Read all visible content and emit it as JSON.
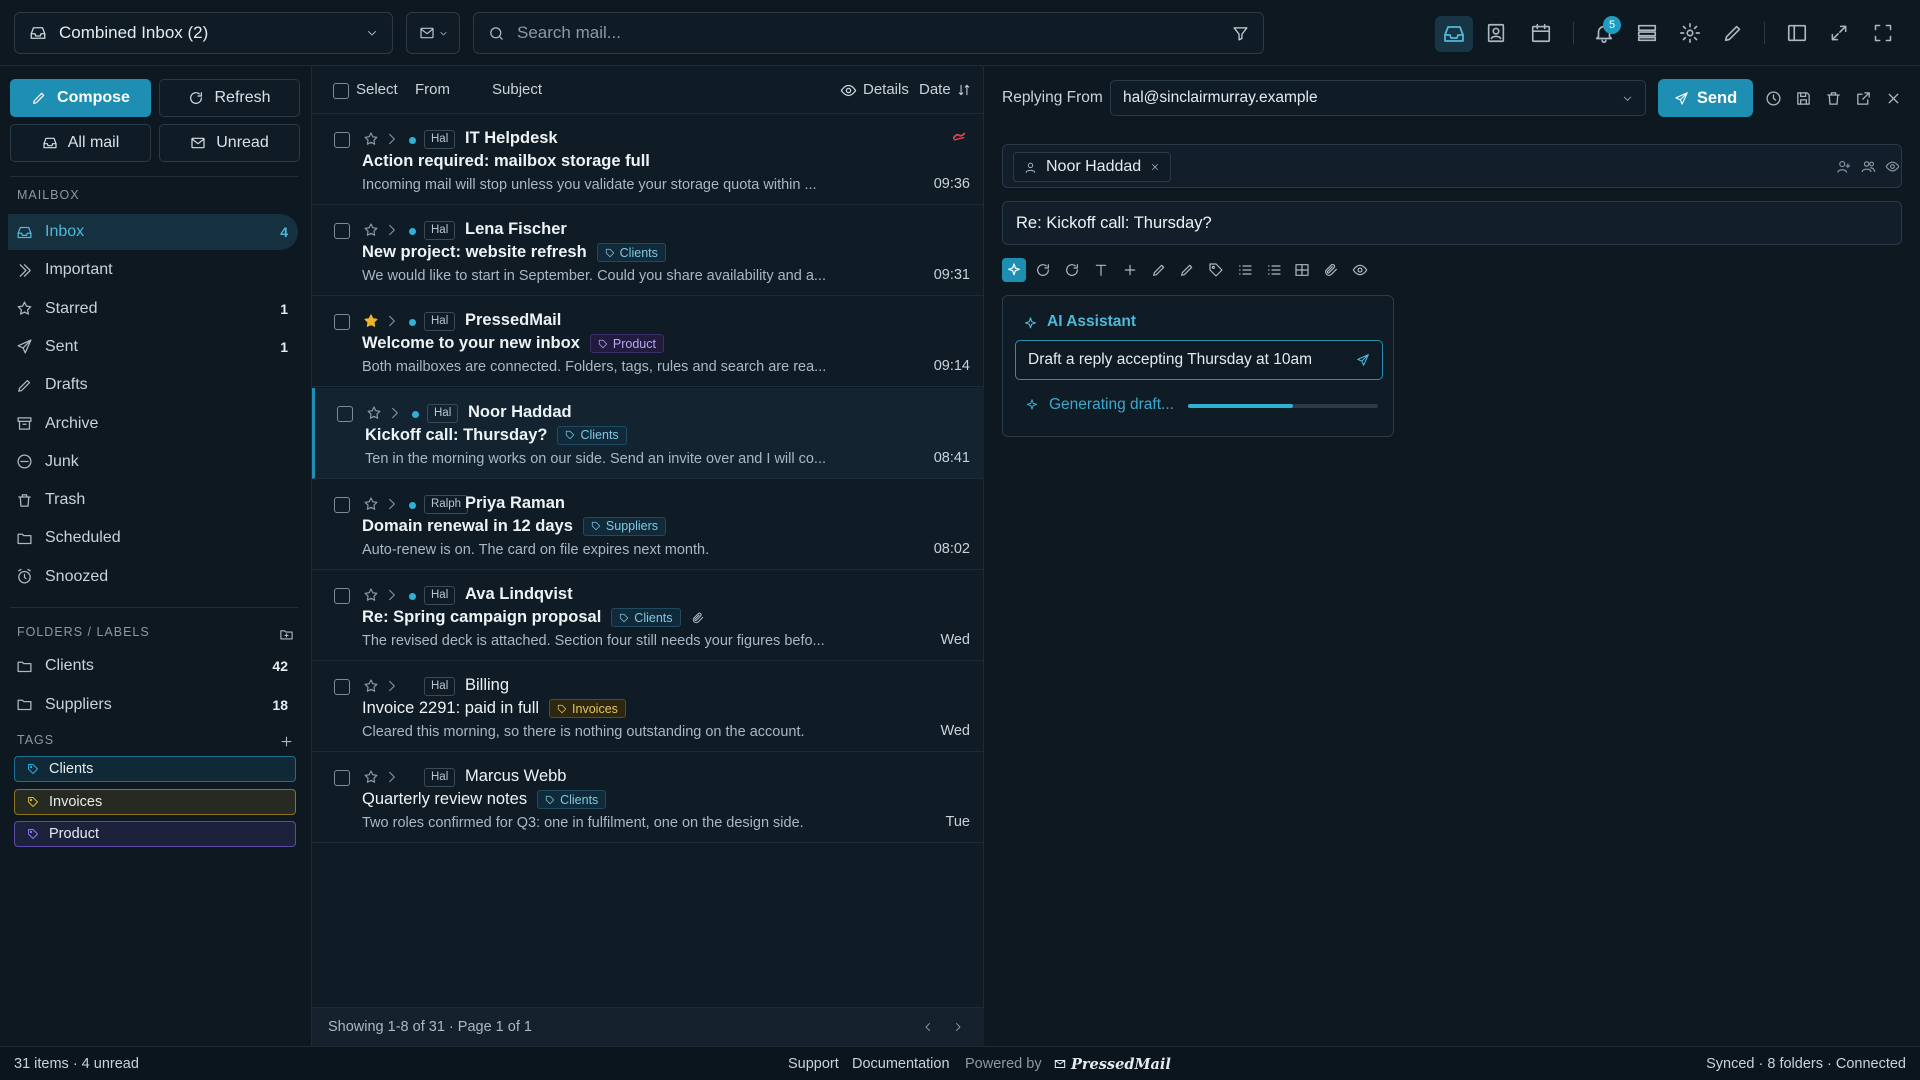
{
  "topbar": {
    "inbox_select": "Combined Inbox (2)",
    "search_placeholder": "Search mail...",
    "notification_count": "5"
  },
  "sidebar": {
    "compose_label": "Compose",
    "refresh_label": "Refresh",
    "all_mail_label": "All mail",
    "unread_label": "Unread",
    "mailbox_title": "MAILBOX",
    "items": [
      {
        "label": "Inbox",
        "count": "4",
        "icon": "inbox-icon"
      },
      {
        "label": "Important",
        "count": "",
        "icon": "important-icon"
      },
      {
        "label": "Starred",
        "count": "1",
        "icon": "star-icon"
      },
      {
        "label": "Sent",
        "count": "1",
        "icon": "send-icon"
      },
      {
        "label": "Drafts",
        "count": "",
        "icon": "pencil-icon"
      },
      {
        "label": "Archive",
        "count": "",
        "icon": "archive-icon"
      },
      {
        "label": "Junk",
        "count": "",
        "icon": "junk-icon"
      },
      {
        "label": "Trash",
        "count": "",
        "icon": "trash-icon"
      },
      {
        "label": "Scheduled",
        "count": "",
        "icon": "folder-icon"
      },
      {
        "label": "Snoozed",
        "count": "",
        "icon": "alarm-icon"
      }
    ],
    "folders_title": "FOLDERS / LABELS",
    "folders": [
      {
        "label": "Clients",
        "count": "42"
      },
      {
        "label": "Suppliers",
        "count": "18"
      }
    ],
    "tags_title": "TAGS",
    "tags": [
      {
        "label": "Clients",
        "color": "#1b6f91"
      },
      {
        "label": "Invoices",
        "color": "#8a7420"
      },
      {
        "label": "Product",
        "color": "#5b4aa8"
      }
    ]
  },
  "list": {
    "header": {
      "select": "Select",
      "from": "From",
      "subject": "Subject",
      "details": "Details",
      "date": "Date"
    },
    "rows": [
      {
        "account": "Hal",
        "sender": "IT Helpdesk",
        "subject": "Action required: mailbox storage full",
        "label": "",
        "preview": "Incoming mail will stop unless you validate your storage quota within ...",
        "time": "09:36",
        "unread": true,
        "starred": false,
        "flag": true,
        "attachment": false
      },
      {
        "account": "Hal",
        "sender": "Lena Fischer",
        "subject": "New project: website refresh",
        "label": "Clients",
        "preview": "We would like to start in September. Could you share availability and a...",
        "time": "09:31",
        "unread": true,
        "starred": false,
        "flag": false,
        "attachment": false
      },
      {
        "account": "Hal",
        "sender": "PressedMail",
        "subject": "Welcome to your new inbox",
        "label": "Product",
        "preview": "Both mailboxes are connected. Folders, tags, rules and search are rea...",
        "time": "09:14",
        "unread": true,
        "starred": true,
        "flag": false,
        "attachment": false
      },
      {
        "account": "Hal",
        "sender": "Noor Haddad",
        "subject": "Kickoff call: Thursday?",
        "label": "Clients",
        "preview": "Ten in the morning works on our side. Send an invite over and I will co...",
        "time": "08:41",
        "unread": true,
        "starred": false,
        "flag": false,
        "attachment": false,
        "selected": true
      },
      {
        "account": "Ralph",
        "sender": "Priya Raman",
        "subject": "Domain renewal in 12 days",
        "label": "Suppliers",
        "preview": "Auto-renew is on. The card on file expires next month.",
        "time": "08:02",
        "unread": true,
        "starred": false,
        "flag": false,
        "attachment": false
      },
      {
        "account": "Hal",
        "sender": "Ava Lindqvist",
        "subject": "Re: Spring campaign proposal",
        "label": "Clients",
        "preview": "The revised deck is attached. Section four still needs your figures befo...",
        "time": "Wed",
        "unread": true,
        "starred": false,
        "flag": false,
        "attachment": true
      },
      {
        "account": "Hal",
        "sender": "Billing",
        "subject": "Invoice 2291: paid in full",
        "label": "Invoices",
        "preview": "Cleared this morning, so there is nothing outstanding on the account.",
        "time": "Wed",
        "unread": false,
        "starred": false,
        "flag": false,
        "attachment": false
      },
      {
        "account": "Hal",
        "sender": "Marcus Webb",
        "subject": "Quarterly review notes",
        "label": "Clients",
        "preview": "Two roles confirmed for Q3: one in fulfilment, one on the design side.",
        "time": "Tue",
        "unread": false,
        "starred": false,
        "flag": false,
        "attachment": false
      }
    ],
    "footer": "Showing 1-8 of 31 · Page 1 of 1"
  },
  "composer": {
    "replying_from_label": "Replying From",
    "from_address": "hal@sinclairmurray.example",
    "send_label": "Send",
    "recipient": "Noor Haddad",
    "subject": "Re: Kickoff call: Thursday?",
    "ai": {
      "title": "AI Assistant",
      "prompt": "Draft a reply accepting Thursday at 10am",
      "status": "Generating draft...",
      "progress": 0.55
    }
  },
  "statusbar": {
    "left": "31 items · 4 unread",
    "support": "Support",
    "documentation": "Documentation",
    "powered_by": "Powered by",
    "logo": "PressedMail",
    "right": "Synced · 8 folders · Connected"
  },
  "colors": {
    "accent": "#1e8fb3",
    "accent_text": "#4fb8d8",
    "flag": "#e0434f",
    "star": "#f0b429"
  }
}
